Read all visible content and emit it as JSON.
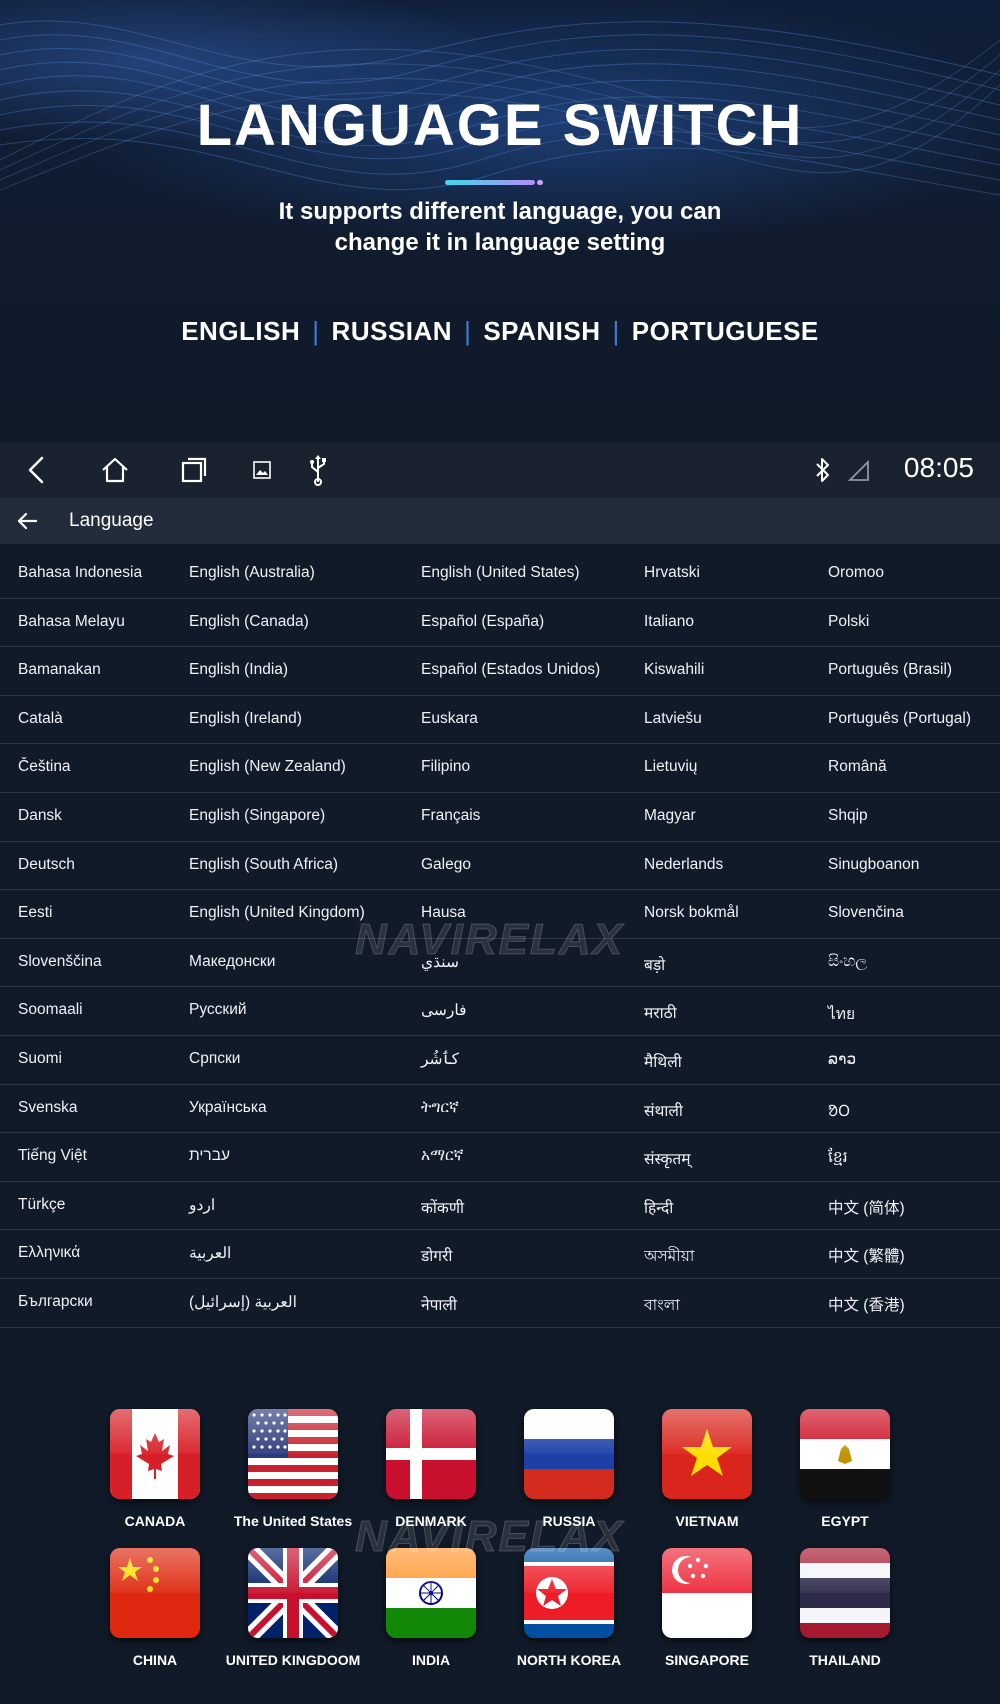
{
  "hero": {
    "title": "LANGUAGE SWITCH",
    "subtitle_line1": "It supports different language, you can",
    "subtitle_line2": "change it in language setting",
    "languages": [
      "ENGLISH",
      "RUSSIAN",
      "SPANISH",
      "PORTUGUESE"
    ],
    "separator": "|"
  },
  "status_bar": {
    "time": "08:05",
    "icons": [
      "back-icon",
      "home-icon",
      "recents-icon",
      "gallery-icon",
      "usb-icon",
      "bluetooth-icon",
      "signal-icon"
    ]
  },
  "app_bar": {
    "title": "Language"
  },
  "language_grid": [
    [
      "Bahasa Indonesia",
      "English (Australia)",
      "English (United States)",
      "Hrvatski",
      "Oromoo"
    ],
    [
      "Bahasa Melayu",
      "English (Canada)",
      "Español (España)",
      "Italiano",
      "Polski"
    ],
    [
      "Bamanakan",
      "English (India)",
      "Español (Estados Unidos)",
      "Kiswahili",
      "Português (Brasil)"
    ],
    [
      "Català",
      "English (Ireland)",
      "Euskara",
      "Latviešu",
      "Português (Portugal)"
    ],
    [
      "Čeština",
      "English (New Zealand)",
      "Filipino",
      "Lietuvių",
      "Română"
    ],
    [
      "Dansk",
      "English (Singapore)",
      "Français",
      "Magyar",
      "Shqip"
    ],
    [
      "Deutsch",
      "English (South Africa)",
      "Galego",
      "Nederlands",
      "Sinugboanon"
    ],
    [
      "Eesti",
      "English (United Kingdom)",
      "Hausa",
      "Norsk bokmål",
      "Slovenčina"
    ],
    [
      "Slovenščina",
      "Македонски",
      "سنڌي",
      "बड़ो",
      "සිංහල"
    ],
    [
      "Soomaali",
      "Русский",
      "فارسی",
      "मराठी",
      "ไทย"
    ],
    [
      "Suomi",
      "Српски",
      "کٲشُر",
      "मैथिली",
      "ລາວ"
    ],
    [
      "Svenska",
      "Українська",
      "ትግርኛ",
      "संथाली",
      "ᱚᱛ"
    ],
    [
      "Tiếng Việt",
      "עברית",
      "አማርኛ",
      "संस्कृतम्",
      "ខ្មែរ"
    ],
    [
      "Türkçe",
      "اردو",
      "कोंकणी",
      "हिन्दी",
      "中文 (简体)"
    ],
    [
      "Ελληνικά",
      "العربية",
      "डोगरी",
      "অসমীয়া",
      "中文 (繁體)"
    ],
    [
      "Български",
      "العربية (إسرائيل)",
      "नेपाली",
      "বাংলা",
      "中文 (香港)"
    ]
  ],
  "flags": [
    {
      "name": "CANADA",
      "icon": "canada-flag-icon"
    },
    {
      "name": "The United States",
      "icon": "usa-flag-icon"
    },
    {
      "name": "DENMARK",
      "icon": "denmark-flag-icon"
    },
    {
      "name": "RUSSIA",
      "icon": "russia-flag-icon"
    },
    {
      "name": "VIETNAM",
      "icon": "vietnam-flag-icon"
    },
    {
      "name": "EGYPT",
      "icon": "egypt-flag-icon"
    },
    {
      "name": "CHINA",
      "icon": "china-flag-icon"
    },
    {
      "name": "UNITED KINGDOOM",
      "icon": "uk-flag-icon"
    },
    {
      "name": "INDIA",
      "icon": "india-flag-icon"
    },
    {
      "name": "NORTH KOREA",
      "icon": "north-korea-flag-icon"
    },
    {
      "name": "SINGAPORE",
      "icon": "singapore-flag-icon"
    },
    {
      "name": "THAILAND",
      "icon": "thailand-flag-icon"
    }
  ],
  "watermark": "NAVIRELAX",
  "colors": {
    "background": "#111a28",
    "status_bar": "#1a2230",
    "app_bar": "#232c3a",
    "divider": "#2d3747",
    "accent_separator": "#3c7fd6"
  }
}
